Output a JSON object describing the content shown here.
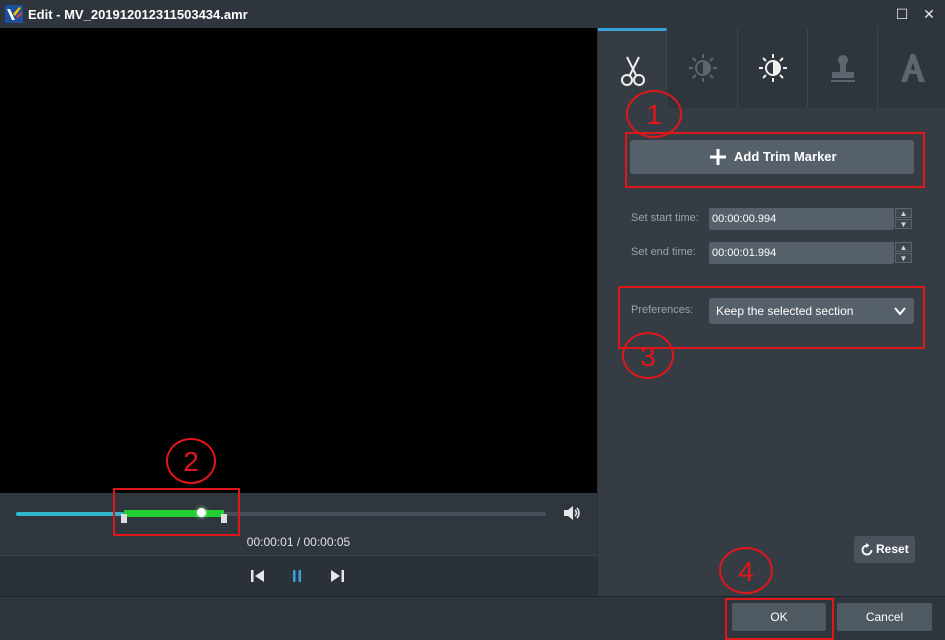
{
  "window": {
    "title": "Edit - MV_201912012311503434.amr",
    "maximize_glyph": "☐",
    "close_glyph": "✕"
  },
  "player": {
    "timecode": "00:00:01 / 00:00:05",
    "accent_color": "#30b8c8",
    "selection_color": "#22cc33"
  },
  "tabs": [
    {
      "name": "trim",
      "icon": "scissors-icon",
      "active": true
    },
    {
      "name": "adjust",
      "icon": "brightness-icon",
      "active": false
    },
    {
      "name": "effect",
      "icon": "sun-icon",
      "active": false
    },
    {
      "name": "watermark",
      "icon": "stamp-icon",
      "active": false
    },
    {
      "name": "text",
      "icon": "text-a-icon",
      "active": false
    }
  ],
  "trim": {
    "add_marker_label": "Add Trim Marker",
    "start_label": "Set start time:",
    "start_value": "00:00:00.994",
    "end_label": "Set end time:",
    "end_value": "00:00:01.994",
    "preferences_label": "Preferences:",
    "preferences_value": "Keep the selected section",
    "reset_label": "Reset"
  },
  "footer": {
    "ok_label": "OK",
    "cancel_label": "Cancel"
  },
  "annotations": {
    "one": "1",
    "two": "2",
    "three": "3",
    "four": "4",
    "color": "#e0171a"
  }
}
